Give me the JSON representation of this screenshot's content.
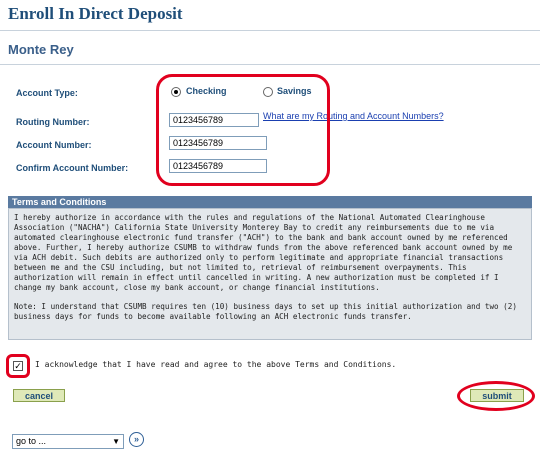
{
  "page": {
    "title": "Enroll In Direct Deposit",
    "person_name": "Monte Rey"
  },
  "form": {
    "account_type_label": "Account Type:",
    "account_type_options": [
      {
        "label": "Checking",
        "selected": true
      },
      {
        "label": "Savings",
        "selected": false
      }
    ],
    "routing_number_label": "Routing Number:",
    "routing_number_value": "0123456789",
    "help_link": "What are my Routing and Account Numbers?",
    "account_number_label": "Account Number:",
    "account_number_value": "0123456789",
    "confirm_account_label": "Confirm Account Number:",
    "confirm_account_value": "0123456789"
  },
  "terms": {
    "header": "Terms and Conditions",
    "paragraph_1": "I hereby authorize in accordance with the rules and regulations of the National Automated Clearinghouse Association (\"NACHA\") California State University Monterey Bay to credit any reimbursements due to me via automated clearinghouse electronic fund transfer (\"ACH\") to the bank and bank account owned by me referenced above. Further, I hereby authorize CSUMB to withdraw funds from the above referenced bank account owned by me via ACH debit. Such debits are authorized only to perform legitimate and appropriate financial transactions between me and the CSU including, but not limited to, retrieval of reimbursement overpayments. This authorization will remain in effect until cancelled in writing. A new authorization must be completed if I change my bank account, close my bank account, or change financial institutions.",
    "paragraph_2": "Note: I understand that CSUMB requires ten (10) business days to set up this initial authorization and two (2) business days for funds to become available following an ACH electronic funds transfer."
  },
  "acknowledge": {
    "checked": true,
    "check_mark": "✓",
    "text": "I acknowledge that I have read and agree to the above Terms and Conditions."
  },
  "buttons": {
    "cancel": "cancel",
    "submit": "submit"
  },
  "goto": {
    "selected": "go to ...",
    "arrow": "▼",
    "go_icon": "»"
  },
  "colors": {
    "highlight_red": "#e1001e",
    "title_blue": "#1f4e79",
    "button_green": "#dfe9b8"
  }
}
